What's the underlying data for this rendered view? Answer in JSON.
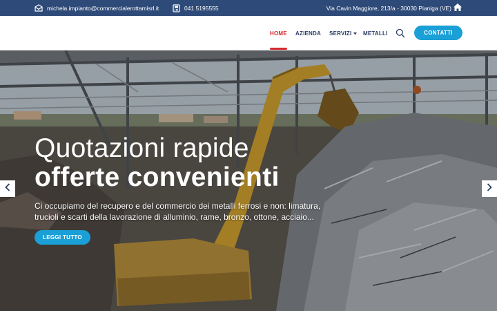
{
  "topbar": {
    "email": "michela.impianto@commercialerottamisrl.it",
    "phone": "041 5195555",
    "address": "Via Cavin Maggiore, 213/a - 30030 Pianiga (VE)",
    "bg_color": "#2e4a78"
  },
  "nav": {
    "home": "HOME",
    "azienda": "AZIENDA",
    "servizi": "SERVIZI",
    "metalli": "METALLI",
    "contatti": "CONTATTI",
    "active_color": "#d6282c",
    "accent_color": "#1a9fd6"
  },
  "hero": {
    "title_line1": "Quotazioni rapide",
    "title_line2": "offerte convenienti",
    "description": "Ci occupiamo del recupero e del commercio dei metalli ferrosi e non: limatura, trucioli e scarti della lavorazione di alluminio, rame, bronzo, ottone, acciaio...",
    "button": "LEGGI TUTTO"
  },
  "icons": {
    "email": "envelope-icon",
    "phone": "phone-icon",
    "home": "home-icon",
    "search": "search-icon",
    "prev": "chevron-left-icon",
    "next": "chevron-right-icon",
    "dropdown": "chevron-down-icon"
  }
}
